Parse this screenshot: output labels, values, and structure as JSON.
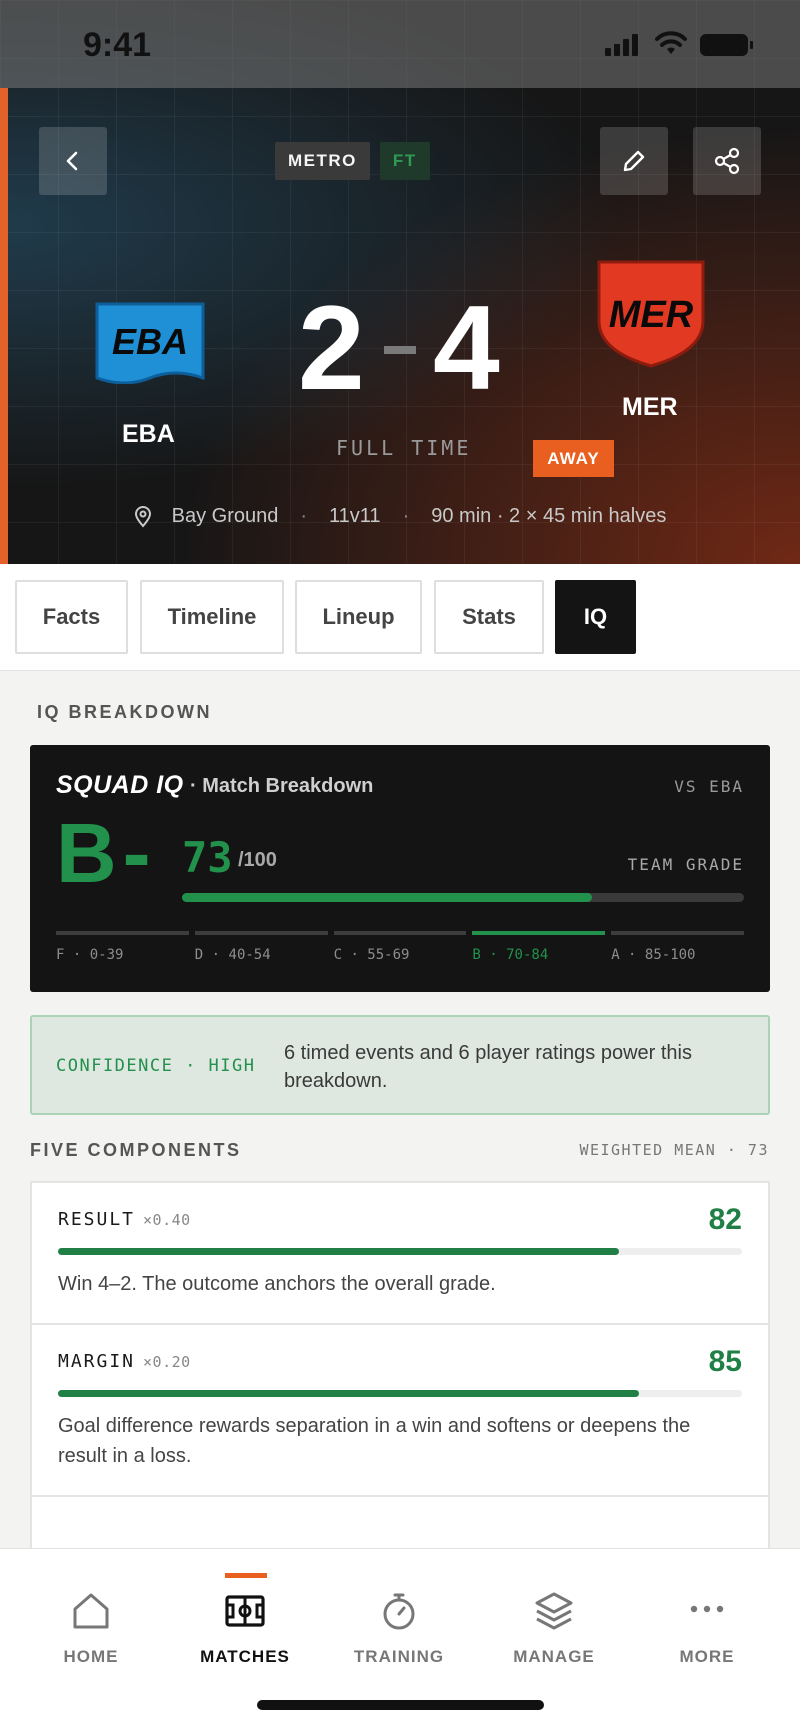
{
  "status": {
    "time": "9:41"
  },
  "header": {
    "league_chip": "METRO",
    "status_chip": "FT",
    "home": {
      "abbr": "EBA",
      "name": "EBA",
      "score": "2",
      "color": "#1f8fd6"
    },
    "away": {
      "abbr": "MER",
      "name": "MER",
      "score": "4",
      "color": "#e23a22"
    },
    "full_time_label": "FULL TIME",
    "away_badge": "AWAY",
    "venue": "Bay Ground",
    "format": "11v11",
    "duration": "90 min · 2 × 45 min halves",
    "separator": "·"
  },
  "tabs": [
    {
      "label": "Facts",
      "active": false
    },
    {
      "label": "Timeline",
      "active": false
    },
    {
      "label": "Lineup",
      "active": false
    },
    {
      "label": "Stats",
      "active": false
    },
    {
      "label": "IQ",
      "active": true
    }
  ],
  "iq": {
    "section_label": "IQ BREAKDOWN",
    "title": "SQUAD IQ",
    "subtitle": "· Match Breakdown",
    "vs": "VS EBA",
    "grade": "B-",
    "score": "73",
    "score_value": 73,
    "max": "/100",
    "team_grade_label": "TEAM GRADE",
    "accent": "#22914c",
    "scale": [
      {
        "label": "F · 0-39",
        "active": false
      },
      {
        "label": "D · 40-54",
        "active": false
      },
      {
        "label": "C · 55-69",
        "active": false
      },
      {
        "label": "B · 70-84",
        "active": true
      },
      {
        "label": "A · 85-100",
        "active": false
      }
    ]
  },
  "confidence": {
    "label": "CONFIDENCE · HIGH",
    "text": "6 timed events and 6 player ratings power this breakdown."
  },
  "components": {
    "section_label": "FIVE COMPONENTS",
    "weighted_label": "WEIGHTED MEAN · 73",
    "items": [
      {
        "name": "RESULT",
        "weight": "×0.40",
        "score": "82",
        "value": 82,
        "desc": "Win 4–2. The outcome anchors the overall grade."
      },
      {
        "name": "MARGIN",
        "weight": "×0.20",
        "score": "85",
        "value": 85,
        "desc": "Goal difference rewards separation in a win and softens or deepens the result in a loss."
      }
    ]
  },
  "nav": {
    "accent": "#e85f1f",
    "items": [
      {
        "label": "HOME",
        "icon": "home-icon",
        "active": false
      },
      {
        "label": "MATCHES",
        "icon": "pitch-icon",
        "active": true
      },
      {
        "label": "TRAINING",
        "icon": "stopwatch-icon",
        "active": false
      },
      {
        "label": "MANAGE",
        "icon": "layers-icon",
        "active": false
      },
      {
        "label": "MORE",
        "icon": "more-icon",
        "active": false
      }
    ]
  }
}
